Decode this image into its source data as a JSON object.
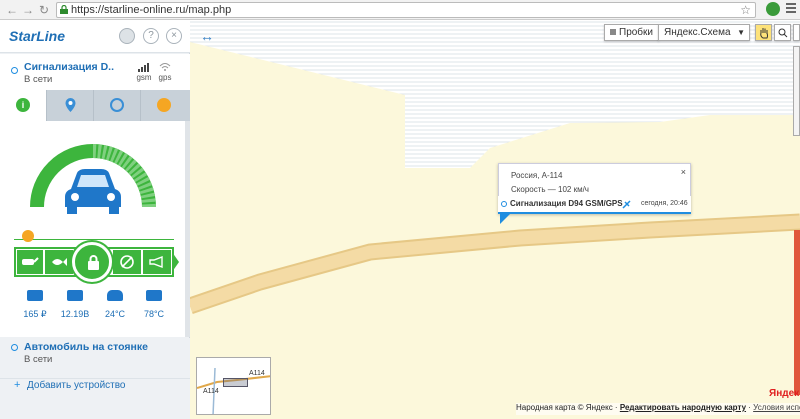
{
  "browser": {
    "url": "https://starline-online.ru/map.php"
  },
  "sidebar": {
    "logo": "StarLine",
    "device1": {
      "name": "Сигнализация D..",
      "status": "В сети",
      "gsm": "gsm",
      "gps": "gps"
    },
    "stats": [
      {
        "icon": "balance-icon",
        "value": "165 ₽"
      },
      {
        "icon": "battery-icon",
        "value": "12.19В"
      },
      {
        "icon": "car-temp-icon",
        "value": "24°C"
      },
      {
        "icon": "engine-temp-icon",
        "value": "78°C"
      }
    ],
    "device2": {
      "name": "Автомобиль на стоянке",
      "status": "В сети"
    },
    "add_device": "Добавить устройство"
  },
  "map": {
    "traffic_label": "Пробки",
    "layer_select": "Яндекс.Схема",
    "popup": {
      "address": "Россия, А-114",
      "speed": "Скорость — 102 км/ч",
      "device": "Сигнализация D94 GSM/GPS",
      "time": "сегодня, 20:46"
    },
    "minimap": {
      "road_label_1": "A114",
      "road_label_2": "A114"
    },
    "copyright": {
      "text": "Народная карта © Яндекс · ",
      "link1": "Редактировать народную карту",
      "separator": " · ",
      "link2": "Условия использовани"
    },
    "watermark": "Яндек"
  },
  "colors": {
    "accent": "#1f8de0",
    "green": "#3db53d",
    "road": "#f4dba5"
  }
}
